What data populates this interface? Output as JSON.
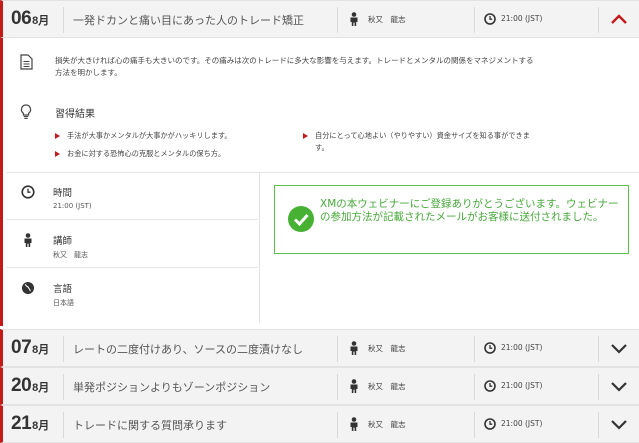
{
  "sessions": [
    {
      "day": "06",
      "month_suffix": "8月",
      "title": "一発ドカンと痛い目にあった人のトレード矯正",
      "presenter": "秋又　龍志",
      "time": "21:00 (JST)",
      "expanded": true
    },
    {
      "day": "07",
      "month_suffix": "8月",
      "title": "レートの二度付けあり、ソースの二度漬けなし",
      "presenter": "秋又　龍志",
      "time": "21:00 (JST)",
      "expanded": false
    },
    {
      "day": "20",
      "month_suffix": "8月",
      "title": "単発ポジションよりもゾーンポジション",
      "presenter": "秋又　龍志",
      "time": "21:00 (JST)",
      "expanded": false
    },
    {
      "day": "21",
      "month_suffix": "8月",
      "title": "トレードに関する質問承ります",
      "presenter": "秋又　龍志",
      "time": "21:00 (JST)",
      "expanded": false
    }
  ],
  "detail": {
    "description": "損失が大きければ心の痛手も大きいのです。その痛みは次のトレードに多大な影響を与えます。トレードとメンタルの関係をマネジメントする方法を明かします。",
    "results_title": "習得結果",
    "results": [
      "手法が大事かメンタルが大事かがハッキリします。",
      "自分にとって心地よい（やりやすい）資金サイズを知る事ができます。",
      "お金に対する恐怖心の克服とメンタルの保ち方。"
    ],
    "meta": {
      "time_label": "時間",
      "time_value": "21:00 (JST)",
      "speaker_label": "講師",
      "speaker_value": "秋又　龍志",
      "language_label": "言語",
      "language_value": "日本語"
    },
    "success_message": "XMの本ウェビナーにご登録ありがとうございます。ウェビナーの参加方法が記載されたメールがお客様に送付されました。"
  },
  "colors": {
    "accent": "#c41a1a",
    "success": "#47b133"
  },
  "icons": [
    "person-icon",
    "clock-icon",
    "chevron-up-icon",
    "chevron-down-icon",
    "document-icon",
    "lightbulb-icon",
    "globe-icon",
    "checkmark-icon"
  ]
}
